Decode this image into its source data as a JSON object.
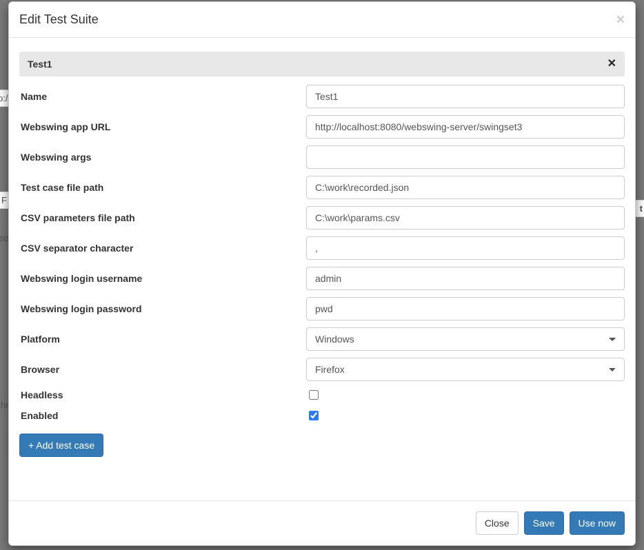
{
  "bg": {
    "url_fragment": "p://l",
    "row_label": "F",
    "left1": "so",
    "left2": "lho",
    "right_edge": "t"
  },
  "modal": {
    "title": "Edit Test Suite",
    "close_x": "×"
  },
  "panel": {
    "title": "Test1",
    "remove_x": "✕"
  },
  "form": {
    "name": {
      "label": "Name",
      "value": "Test1"
    },
    "url": {
      "label": "Webswing app URL",
      "value": "http://localhost:8080/webswing-server/swingset3"
    },
    "args": {
      "label": "Webswing args",
      "value": ""
    },
    "testfile": {
      "label": "Test case file path",
      "value": "C:\\work\\recorded.json"
    },
    "csvfile": {
      "label": "CSV parameters file path",
      "value": "C:\\work\\params.csv"
    },
    "csvsep": {
      "label": "CSV separator character",
      "value": ","
    },
    "login_user": {
      "label": "Webswing login username",
      "value": "admin"
    },
    "login_pass": {
      "label": "Webswing login password",
      "value": "pwd"
    },
    "platform": {
      "label": "Platform",
      "value": "Windows"
    },
    "browser": {
      "label": "Browser",
      "value": "Firefox"
    },
    "headless": {
      "label": "Headless",
      "checked": false
    },
    "enabled": {
      "label": "Enabled",
      "checked": true
    }
  },
  "buttons": {
    "add_test_case": "+ Add test case",
    "close": "Close",
    "save": "Save",
    "use_now": "Use now"
  }
}
